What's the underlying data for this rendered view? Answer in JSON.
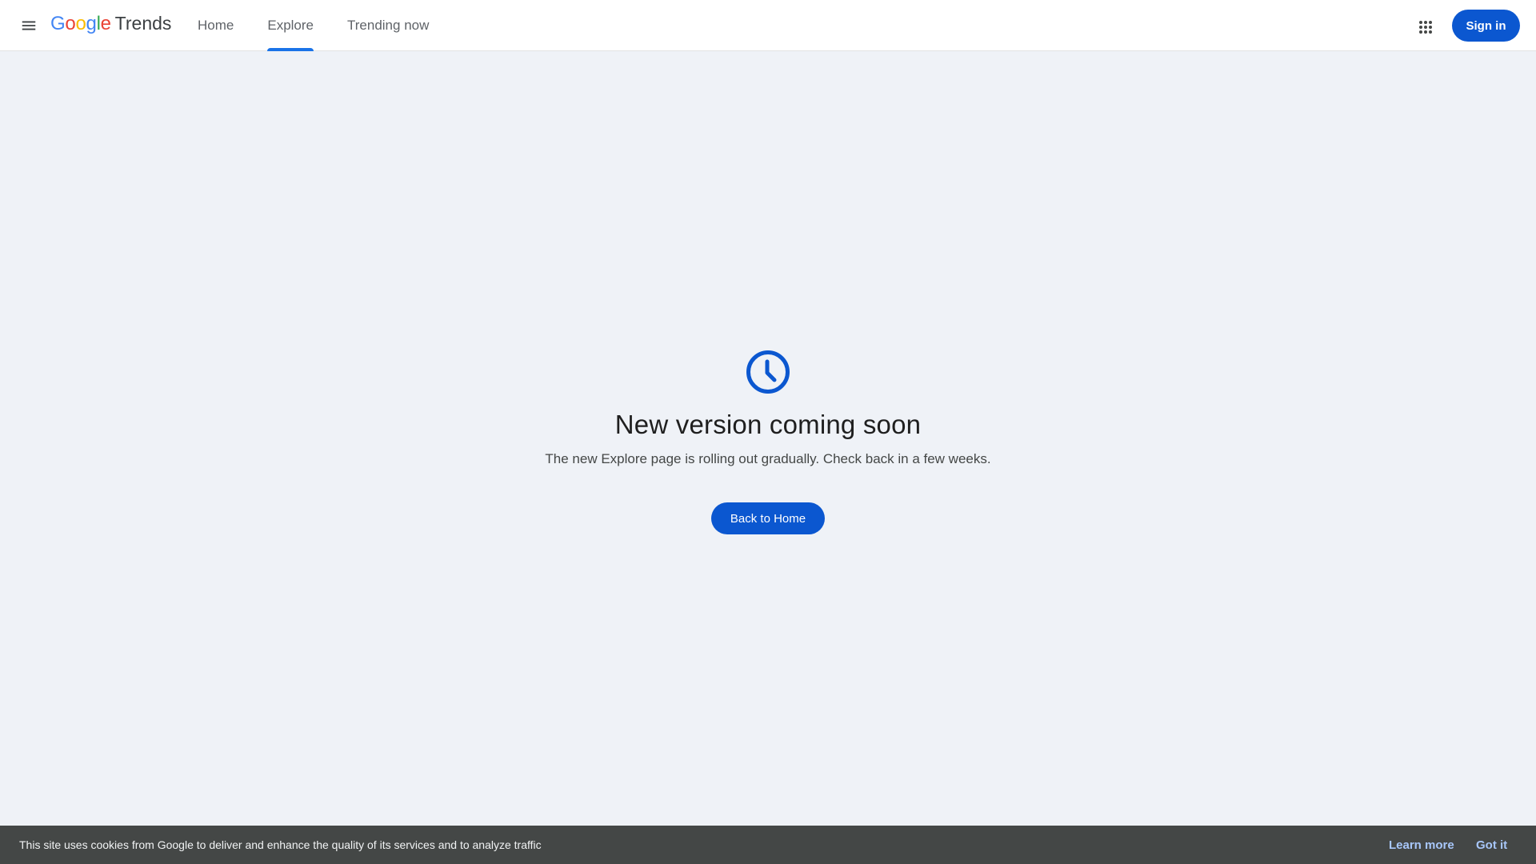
{
  "header": {
    "logo": {
      "google_letters": [
        {
          "ch": "G",
          "color": "#4285F4"
        },
        {
          "ch": "o",
          "color": "#EA4335"
        },
        {
          "ch": "o",
          "color": "#FBBC05"
        },
        {
          "ch": "g",
          "color": "#4285F4"
        },
        {
          "ch": "l",
          "color": "#34A853"
        },
        {
          "ch": "e",
          "color": "#EA4335"
        }
      ],
      "product": "Trends"
    },
    "tabs": [
      {
        "label": "Home",
        "active": false
      },
      {
        "label": "Explore",
        "active": true
      },
      {
        "label": "Trending now",
        "active": false
      }
    ],
    "sign_in_label": "Sign in",
    "icons": {
      "menu": "hamburger-menu-icon",
      "apps": "google-apps-grid-icon"
    }
  },
  "main": {
    "icon": "clock-icon",
    "heading": "New version coming soon",
    "message": "The new Explore page is rolling out gradually. Check back in a few weeks.",
    "button_label": "Back to Home"
  },
  "cookie_banner": {
    "text": "This site uses cookies from Google to deliver and enhance the quality of its services and to analyze traffic",
    "learn_more": "Learn more",
    "got_it": "Got it"
  },
  "colors": {
    "accent": "#0b57d0",
    "tab_indicator": "#1a73e8",
    "page_background": "#eff2f7",
    "cookie_background": "#444746",
    "cookie_link": "#a8c7fa"
  }
}
